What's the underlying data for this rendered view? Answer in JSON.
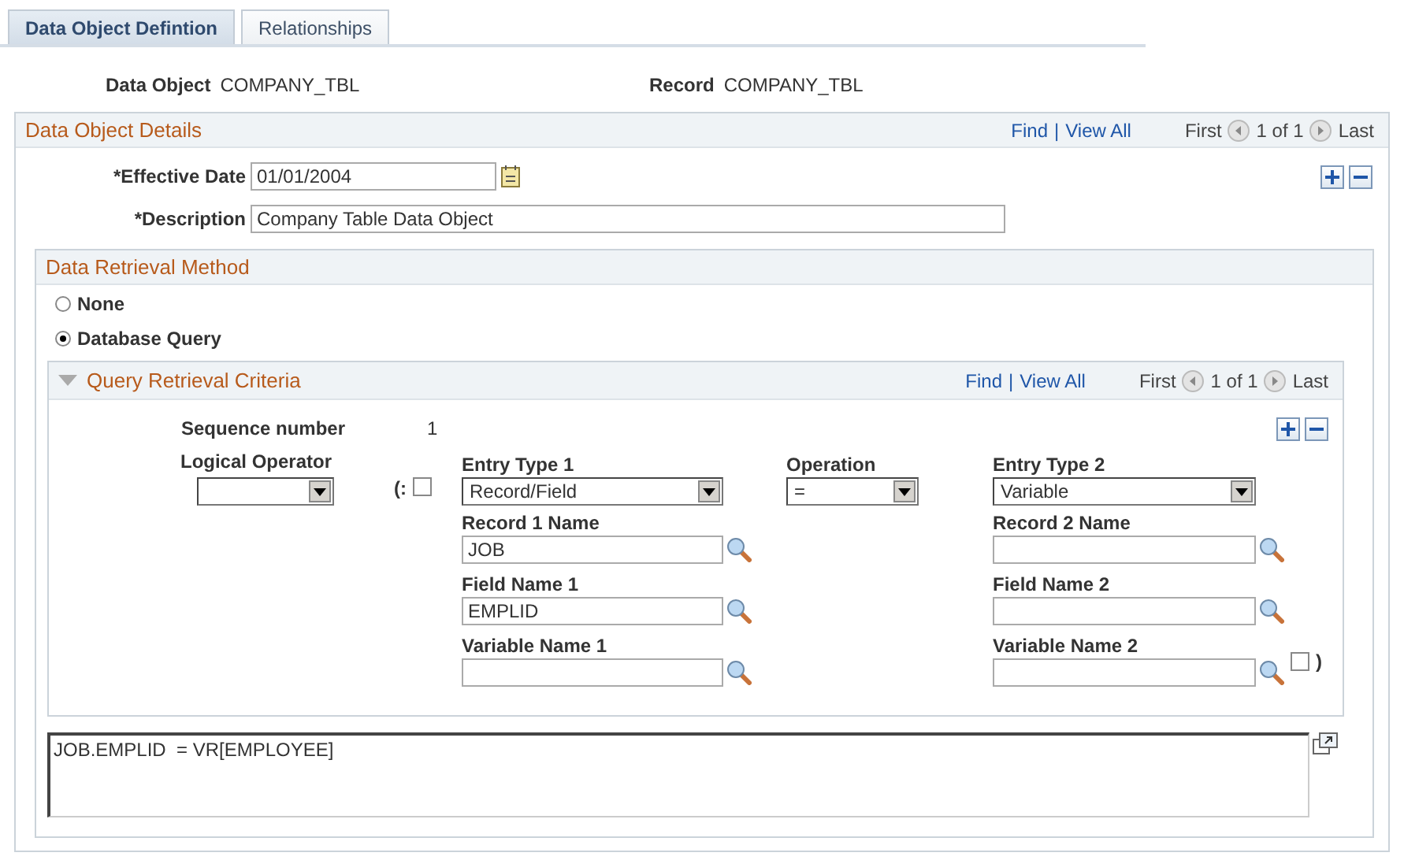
{
  "tabs": [
    {
      "label": "Data Object Defintion",
      "selected": true
    },
    {
      "label": "Relationships",
      "selected": false
    }
  ],
  "summary": [
    {
      "label": "Data Object",
      "value": "COMPANY_TBL"
    },
    {
      "label": "Record",
      "value": "COMPANY_TBL"
    }
  ],
  "details": {
    "title": "Data Object Details",
    "nav": {
      "find": "Find",
      "separator": "|",
      "view_all": "View All",
      "first": "First",
      "count": "1 of 1",
      "last": "Last"
    },
    "effective_date": {
      "label": "*Effective Date",
      "value": "01/01/2004"
    },
    "description": {
      "label": "*Description",
      "value": "Company Table Data Object"
    }
  },
  "retrieval": {
    "title": "Data Retrieval Method",
    "options": [
      {
        "label": "None",
        "selected": false
      },
      {
        "label": "Database Query",
        "selected": true
      }
    ]
  },
  "criteria": {
    "title": "Query Retrieval Criteria",
    "expanded": true,
    "nav": {
      "find": "Find",
      "separator": "|",
      "view_all": "View All",
      "first": "First",
      "count": "1 of 1",
      "last": "Last"
    },
    "sequence": {
      "label": "Sequence number",
      "value": "1"
    },
    "logical_operator": {
      "label": "Logical Operator"
    },
    "open_paren": {
      "label": "(:",
      "checked": false
    },
    "fields_1": [
      {
        "kind": "select",
        "label": "Entry Type 1",
        "value": "Record/Field"
      },
      {
        "kind": "lookup",
        "label": "Record 1 Name",
        "value": "JOB"
      },
      {
        "kind": "lookup",
        "label": "Field Name 1",
        "value": "EMPLID"
      },
      {
        "kind": "lookup",
        "label": "Variable Name 1"
      }
    ],
    "operation": {
      "label": "Operation",
      "value": "="
    },
    "fields_2": [
      {
        "kind": "select",
        "label": "Entry Type 2",
        "value": "Variable"
      },
      {
        "kind": "lookup",
        "label": "Record 2 Name"
      },
      {
        "kind": "lookup",
        "label": "Field Name 2"
      },
      {
        "kind": "lookup",
        "label": "Variable Name 2"
      }
    ],
    "close_paren": {
      "label": ")",
      "checked": false
    }
  },
  "expression": "JOB.EMPLID  = VR[EMPLOYEE]"
}
